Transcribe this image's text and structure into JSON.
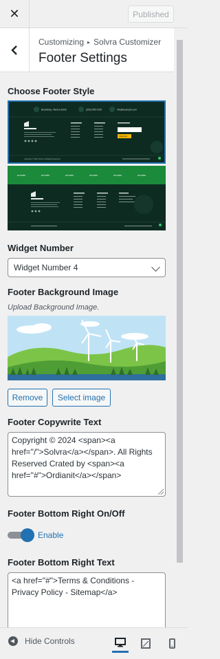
{
  "topbar": {
    "close_icon": "close-icon",
    "publish_label": "Published"
  },
  "header": {
    "breadcrumb_root": "Customizing",
    "breadcrumb_separator": "▸",
    "breadcrumb_section": "Solvra Customizer",
    "title": "Footer Settings"
  },
  "footer_style": {
    "label": "Choose Footer Style",
    "options": [
      {
        "contact_items": [
          "Broadway, Vienna Kehle",
          "(303) 555 0105",
          "info@example.com"
        ],
        "newsletter_button": "Subscribe",
        "copyright": "Copyright © 2024 Solvra. All Rights Reserved",
        "selected": true
      },
      {
        "partner_logos": [
          "envato",
          "envato",
          "envato",
          "envato",
          "envato",
          "envato"
        ],
        "selected": false
      }
    ]
  },
  "widget_number": {
    "label": "Widget Number",
    "value": "Widget Number 4"
  },
  "background_image": {
    "label": "Footer Background Image",
    "description": "Upload Background Image.",
    "remove_label": "Remove",
    "select_label": "Select image"
  },
  "copyright_text": {
    "label": "Footer Copywrite Text",
    "value": "Copyright © 2024 <span><a href=\"/\">Solvra</a></span>. All Rights Reserved Crated by <span><a href=\"#\">Ordianit</a></span>"
  },
  "bottom_right_toggle": {
    "label": "Footer Bottom Right On/Off",
    "state_label": "Enable",
    "enabled": true
  },
  "bottom_right_text": {
    "label": "Footer Bottom Right Text",
    "value": " <a href=\"#\">Terms & Conditions - Privacy Policy - Sitemap</a>"
  },
  "bottom_bar": {
    "hide_controls_label": "Hide Controls",
    "devices": [
      "desktop-icon",
      "tablet-icon",
      "mobile-icon"
    ],
    "active_device": "desktop"
  },
  "colors": {
    "accent": "#2271b1",
    "footer_dark": "#0e2b22",
    "footer_green": "#1b8a3a"
  }
}
